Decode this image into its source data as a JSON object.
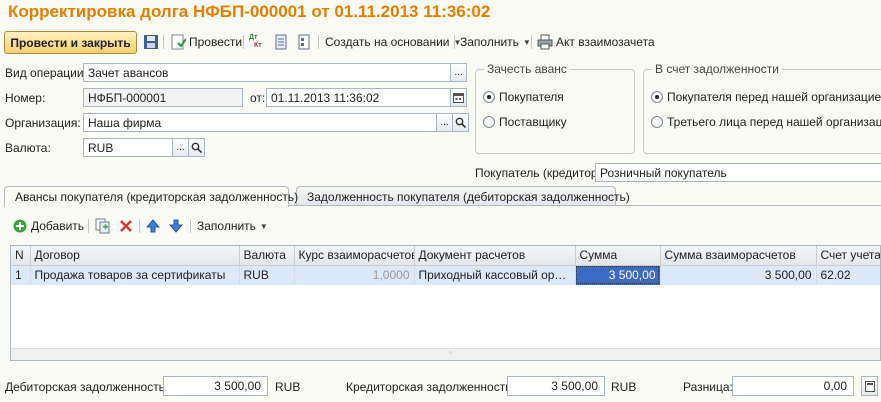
{
  "title": "Корректировка долга НФБП-000001 от 01.11.2013 11:36:02",
  "toolbar": {
    "post_close": "Провести и закрыть",
    "post": "Провести",
    "create_based": "Создать на основании",
    "fill": "Заполнить",
    "act": "Акт взаимозачета",
    "dt_kt_icon_top": "Дт",
    "dt_kt_icon_bottom": "Кт"
  },
  "form": {
    "operation_label": "Вид операции:",
    "operation_value": "Зачет авансов",
    "number_label": "Номер:",
    "number_value": "НФБП-000001",
    "date_label": "от:",
    "date_value": "01.11.2013 11:36:02",
    "org_label": "Организация:",
    "org_value": "Наша фирма",
    "currency_label": "Валюта:",
    "currency_value": "RUB",
    "btn_dots": "...",
    "buyer_label": "Покупатель (кредитор):",
    "buyer_value": "Розничный покупатель"
  },
  "offset_group": {
    "title": "Зачесть аванс",
    "options": [
      "Покупателя",
      "Поставщику"
    ],
    "selected": 0
  },
  "debt_group": {
    "title": "В счет задолженности",
    "options": [
      "Покупателя перед нашей организацией",
      "Третьего лица перед нашей организацией"
    ],
    "selected": 0
  },
  "tabs": [
    "Авансы покупателя (кредиторская задолженность)",
    "Задолженность покупателя (дебиторская задолженность)"
  ],
  "tab_toolbar": {
    "add": "Добавить",
    "fill": "Заполнить"
  },
  "table": {
    "columns": [
      "N",
      "Договор",
      "Валюта",
      "Курс взаиморасчетов",
      "Документ расчетов",
      "Сумма",
      "Сумма взаиморасчетов",
      "Счет учета"
    ],
    "rows": [
      {
        "n": "1",
        "contract": "Продажа товаров за сертификаты",
        "currency": "RUB",
        "rate": "1,0000",
        "document": "Приходный кассовый ордер...",
        "amount": "3 500,00",
        "settle_amount": "3 500,00",
        "account": "62.02"
      }
    ]
  },
  "footer": {
    "debit_label": "Дебиторская задолженность:",
    "debit_value": "3 500,00",
    "debit_cur": "RUB",
    "credit_label": "Кредиторская задолженность:",
    "credit_value": "3 500,00",
    "credit_cur": "RUB",
    "diff_label": "Разница:",
    "diff_value": "0,00"
  },
  "colors": {
    "title": "#e67e00",
    "selected_row": "#dbe9f8",
    "current_cell": "#3b6bc4"
  }
}
